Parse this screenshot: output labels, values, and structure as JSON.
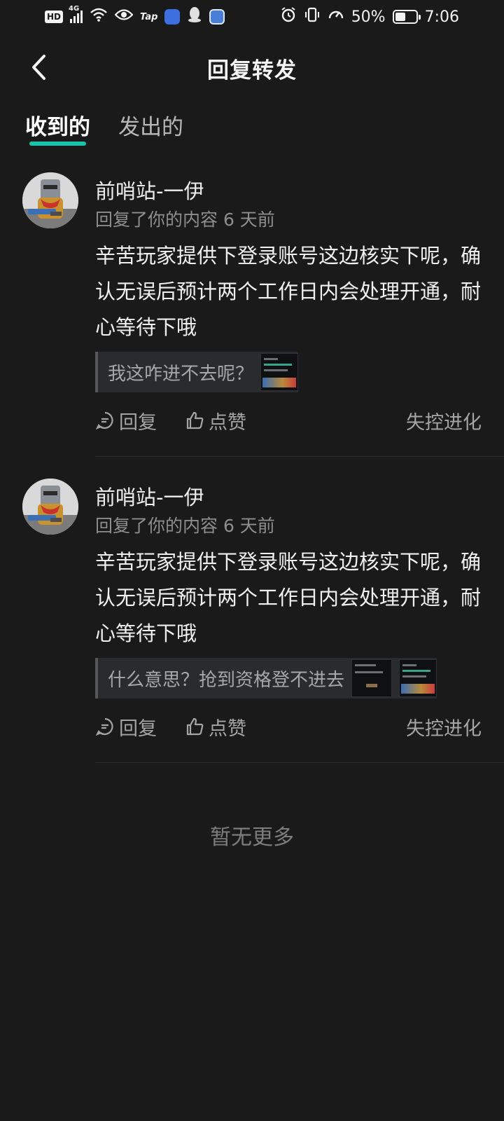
{
  "status_bar": {
    "network_hd": "HD",
    "network_type": "4G",
    "tap_label": "Tap",
    "battery_percent": "50%",
    "battery_level": 0.5,
    "time": "7:06"
  },
  "header": {
    "title": "回复转发"
  },
  "tabs": [
    {
      "label": "收到的",
      "active": true
    },
    {
      "label": "发出的",
      "active": false
    }
  ],
  "replies": [
    {
      "author": "前哨站-一伊",
      "meta": "回复了你的内容 6 天前",
      "text": "辛苦玩家提供下登录账号这边核实下呢，确认无误后预计两个工作日内会处理开通，耐心等待下哦",
      "quote": "我这咋进不去呢？",
      "reply_label": "回复",
      "like_label": "点赞",
      "source": "失控进化"
    },
    {
      "author": "前哨站-一伊",
      "meta": "回复了你的内容 6 天前",
      "text": "辛苦玩家提供下登录账号这边核实下呢，确认无误后预计两个工作日内会处理开通，耐心等待下哦",
      "quote": "什么意思？抢到资格登不进去",
      "reply_label": "回复",
      "like_label": "点赞",
      "source": "失控进化"
    }
  ],
  "empty_state": "暂无更多",
  "colors": {
    "background": "#1a1a1a",
    "accent": "#19c2a8",
    "secondary_text": "#8e8e8e"
  }
}
